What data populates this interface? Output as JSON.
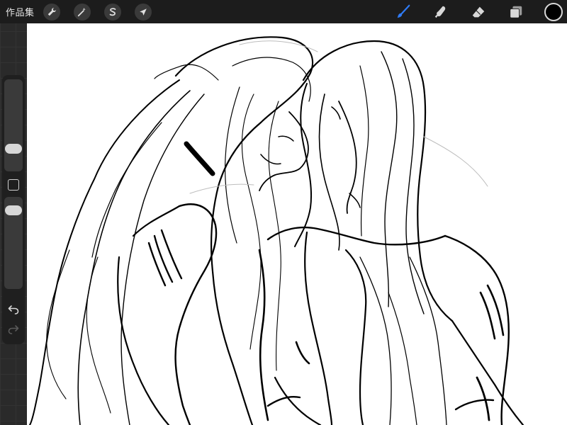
{
  "topbar": {
    "gallery_label": "作品集",
    "left_tools": [
      {
        "name": "wrench-icon",
        "label": "actions"
      },
      {
        "name": "magic-wand-icon",
        "label": "adjustments"
      },
      {
        "name": "selection-s-icon",
        "label": "selection"
      },
      {
        "name": "arrow-cursor-icon",
        "label": "transform"
      }
    ],
    "right_tools": [
      {
        "name": "brush-icon",
        "active": true
      },
      {
        "name": "smudge-icon",
        "active": false
      },
      {
        "name": "eraser-icon",
        "active": false
      },
      {
        "name": "layers-icon",
        "active": false
      }
    ],
    "current_color": "#000000",
    "accent_color": "#2f7bf5"
  },
  "sidebar": {
    "brush_size_level": 0.55,
    "opacity_level": 0.1
  },
  "canvas": {
    "background": "#ffffff",
    "subject": "line-drawing-two-long-haired-figures"
  }
}
